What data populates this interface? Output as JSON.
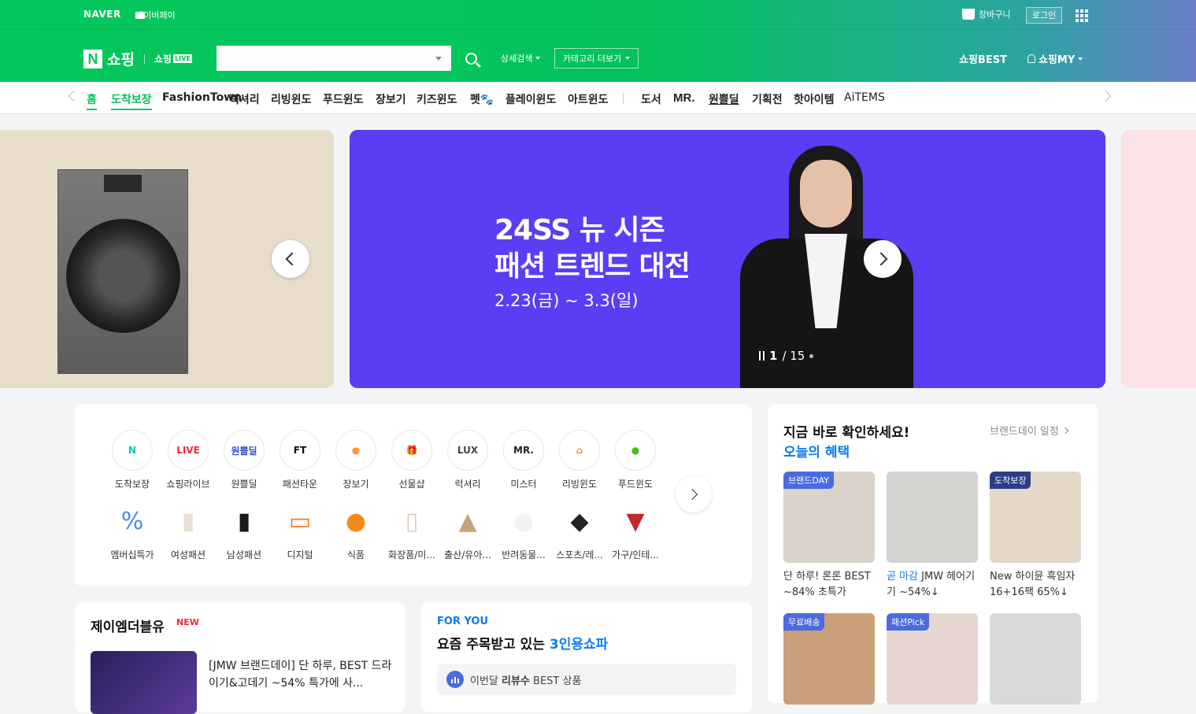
{
  "topbar": {
    "naver": "NAVER",
    "npay": "네이버페이",
    "cart": "장바구니",
    "login": "로그인"
  },
  "header": {
    "logo_n": "N",
    "logo_shop": "쇼핑",
    "logo_live_text": "쇼핑",
    "logo_live_badge": "LIVE",
    "search_value": "",
    "detail_search": "상세검색",
    "category_more": "카테고리 더보기",
    "best": "쇼핑BEST",
    "my": "쇼핑MY"
  },
  "nav": {
    "items": [
      "홈",
      "도착보장",
      "FashionTown",
      "럭셔리",
      "리빙윈도",
      "푸드윈도",
      "장보기",
      "키즈윈도",
      "펫🐾",
      "플레이윈도",
      "아트윈도",
      "도서",
      "MR.",
      "원쁠딜",
      "기획전",
      "핫아이템",
      "AiTEMS"
    ],
    "active_index": 0
  },
  "banner": {
    "line1": "24SS 뉴 시즌",
    "line2": "패션 트렌드 대전",
    "dates": "2.23(금) ~ 3.3(일)",
    "page_current": "1",
    "page_total": "/ 15",
    "bg_color": "#5b3df3"
  },
  "categories": {
    "row1": [
      {
        "label": "도착보장",
        "icon": "delivery-guarantee-icon",
        "glyph": "N",
        "color": "#14c2c2"
      },
      {
        "label": "쇼핑라이브",
        "icon": "live-icon",
        "glyph": "LIVE",
        "color": "#f5263d"
      },
      {
        "label": "원쁠딜",
        "icon": "oneplus-deal-icon",
        "glyph": "원쁠딜",
        "color": "#2d4fc9"
      },
      {
        "label": "패션타운",
        "icon": "fashion-town-icon",
        "glyph": "FT",
        "color": "#111111"
      },
      {
        "label": "장보기",
        "icon": "grocery-icon",
        "glyph": "●",
        "color": "#ff9a3c"
      },
      {
        "label": "선물샵",
        "icon": "gift-icon",
        "glyph": "🎁",
        "color": "#27b25f"
      },
      {
        "label": "럭셔리",
        "icon": "luxury-icon",
        "glyph": "LUX",
        "color": "#444444"
      },
      {
        "label": "미스터",
        "icon": "mister-icon",
        "glyph": "MR.",
        "color": "#222222"
      },
      {
        "label": "리빙윈도",
        "icon": "living-window-icon",
        "glyph": "⌂",
        "color": "#f08a2a"
      },
      {
        "label": "푸드윈도",
        "icon": "food-window-icon",
        "glyph": "●",
        "color": "#3fbf1f"
      }
    ],
    "row2": [
      {
        "label": "멤버십특가",
        "icon": "membership-icon",
        "glyph": "%",
        "color": "#4a8bf0"
      },
      {
        "label": "여성패션",
        "icon": "womens-fashion-icon",
        "glyph": "▮",
        "color": "#e8e0d2"
      },
      {
        "label": "남성패션",
        "icon": "mens-fashion-icon",
        "glyph": "▮",
        "color": "#1a1a1a"
      },
      {
        "label": "디지털",
        "icon": "digital-icon",
        "glyph": "▭",
        "color": "#f07a2a"
      },
      {
        "label": "식품",
        "icon": "food-icon",
        "glyph": "●",
        "color": "#f58a1a"
      },
      {
        "label": "화장품/미...",
        "icon": "cosmetics-icon",
        "glyph": "▯",
        "color": "#e6c9bc"
      },
      {
        "label": "출산/유아...",
        "icon": "baby-icon",
        "glyph": "▲",
        "color": "#c9a27a"
      },
      {
        "label": "반려동물...",
        "icon": "pet-icon",
        "glyph": "●",
        "color": "#f2f2f2"
      },
      {
        "label": "스포츠/레...",
        "icon": "sports-icon",
        "glyph": "◆",
        "color": "#222222"
      },
      {
        "label": "가구/인테...",
        "icon": "furniture-icon",
        "glyph": "▼",
        "color": "#c0282c"
      }
    ]
  },
  "benefit": {
    "title": "지금 바로 확인하세요!",
    "subtitle": "오늘의 혜택",
    "schedule": "브랜드데이 일정",
    "items": [
      {
        "tag": "브랜드DAY",
        "tag_color": "#4c6bdc",
        "desc_hl": "",
        "desc": "단 하루! 론론 BEST ~84% 초특가",
        "bg": "#d9d3ca"
      },
      {
        "tag": "",
        "tag_color": "",
        "desc_hl": "곧 마감",
        "desc": " JMW 헤어기기 ~54%↓",
        "bg": "#d5d3d0"
      },
      {
        "tag": "도착보장",
        "tag_color": "#2a3e88",
        "desc_hl": "",
        "desc": "New 하이뮨 흑임자 16+16팩 65%↓",
        "bg": "#e4d8c8"
      },
      {
        "tag": "무료배송",
        "tag_color": "#4c6bdc",
        "desc_hl": "",
        "desc": "",
        "bg": "#c9a07a"
      },
      {
        "tag": "패션Pick",
        "tag_color": "#4c6bdc",
        "desc_hl": "",
        "desc": "",
        "bg": "#e8d6d0"
      },
      {
        "tag": "",
        "tag_color": "",
        "desc_hl": "",
        "desc": "",
        "bg": "#d9d9d9"
      }
    ]
  },
  "jmw": {
    "title": "제이엠더블유",
    "badge": "NEW",
    "desc": "[JMW 브랜드데이] 단 하루, BEST 드라이기&고데기 ~54% 특가에 사..."
  },
  "foryou": {
    "label": "FOR YOU",
    "headline_pre": "요즘 주목받고 있는 ",
    "headline_hl": "3인용쇼파",
    "row_pre": "이번달 ",
    "row_bold": "리뷰수",
    "row_post": " BEST 상품"
  }
}
